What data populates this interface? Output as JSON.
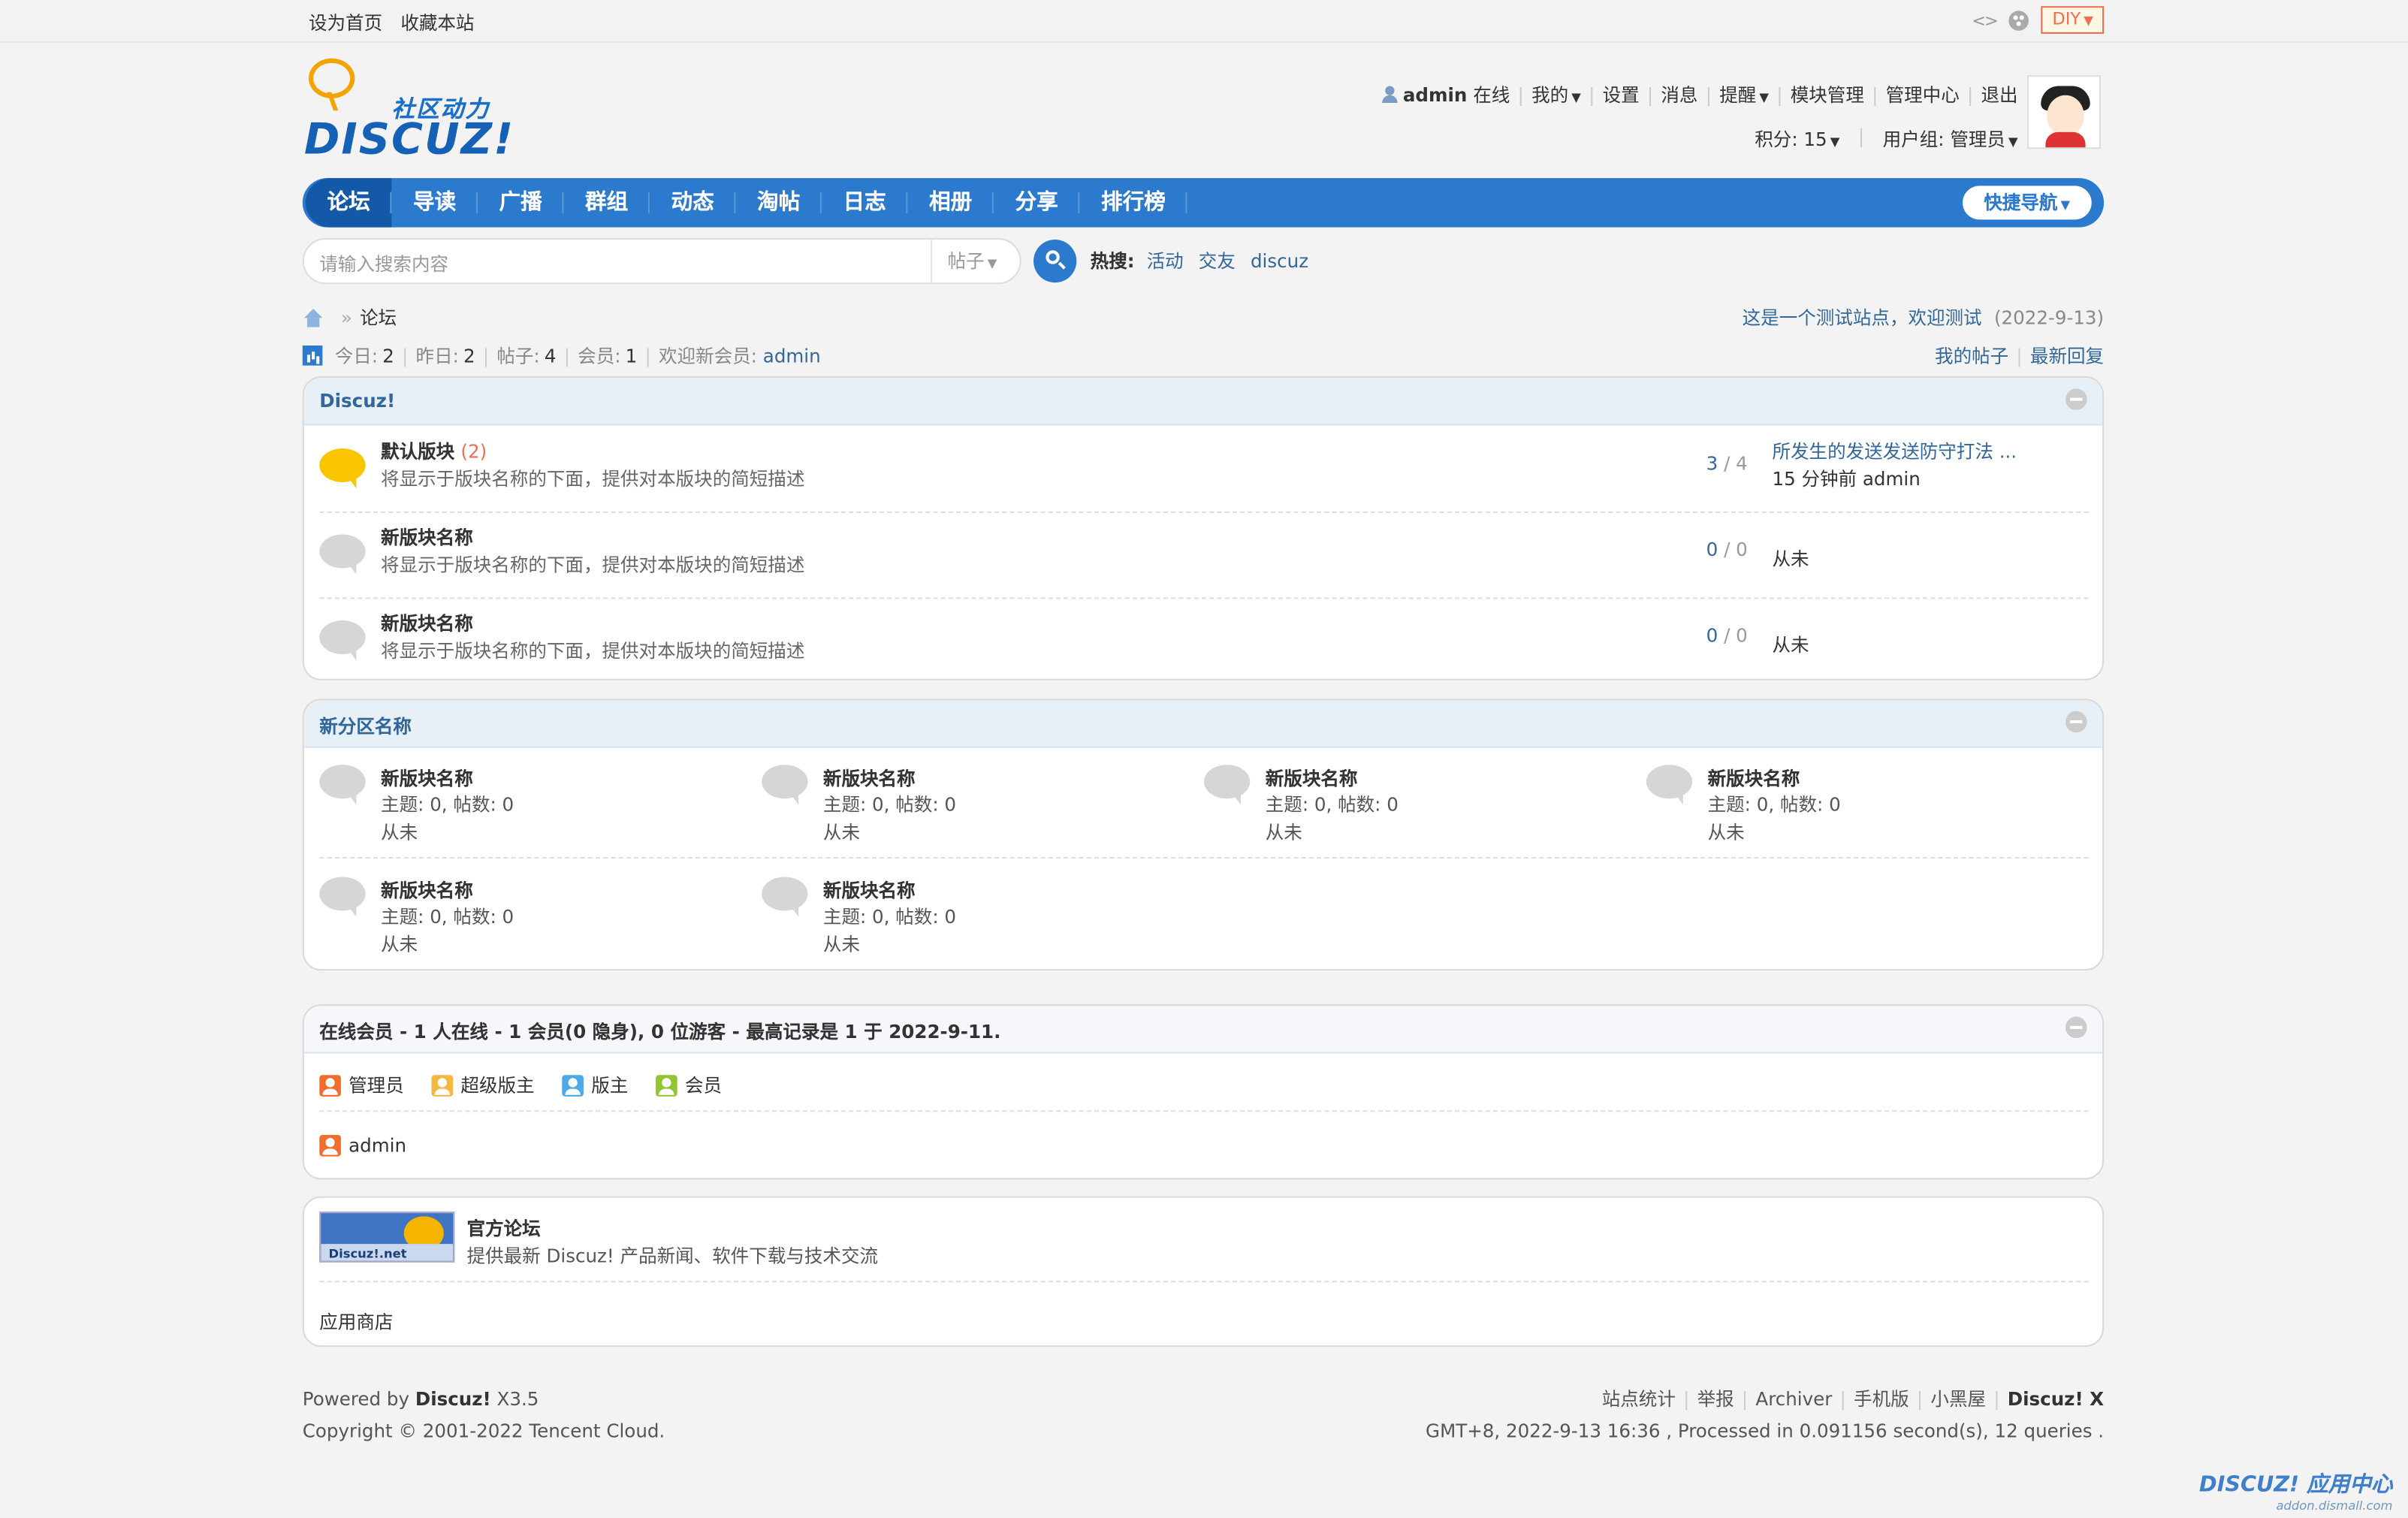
{
  "topbar": {
    "set_home": "设为首页",
    "bookmark": "收藏本站",
    "code_icon": "<>",
    "diy": "DIY"
  },
  "logo": {
    "cn": "社区动力",
    "en": "DISCUZ!"
  },
  "user": {
    "name": "admin",
    "status": "在线",
    "menu": [
      "我的",
      "设置",
      "消息",
      "提醒",
      "模块管理",
      "管理中心",
      "退出"
    ],
    "points_label": "积分: 15",
    "group_label": "用户组: 管理员"
  },
  "nav": {
    "items": [
      "论坛",
      "导读",
      "广播",
      "群组",
      "动态",
      "淘帖",
      "日志",
      "相册",
      "分享",
      "排行榜"
    ],
    "quick": "快捷导航"
  },
  "search": {
    "placeholder": "请输入搜索内容",
    "type": "帖子",
    "hot_label": "热搜:",
    "hot": [
      "活动",
      "交友",
      "discuz"
    ]
  },
  "breadcrumb": {
    "current": "论坛"
  },
  "notice": {
    "text": "这是一个测试站点，欢迎测试",
    "date": "(2022-9-13)"
  },
  "stats": {
    "today_label": "今日:",
    "today": "2",
    "yesterday_label": "昨日:",
    "yesterday": "2",
    "posts_label": "帖子:",
    "posts": "4",
    "members_label": "会员:",
    "members": "1",
    "newest_label": "欢迎新会员:",
    "newest": "admin"
  },
  "mylinks": {
    "my_posts": "我的帖子",
    "latest_reply": "最新回复"
  },
  "category1": {
    "title": "Discuz!",
    "forums": [
      {
        "name": "默认版块",
        "count": "(2)",
        "desc": "将显示于版块名称的下面，提供对本版块的简短描述",
        "threads": "3",
        "posts": "4",
        "last_title": "所发生的发送发送防守打法 ...",
        "last_meta": "15 分钟前 admin"
      },
      {
        "name": "新版块名称",
        "count": "",
        "desc": "将显示于版块名称的下面，提供对本版块的简短描述",
        "threads": "0",
        "posts": "0",
        "last_title": "从未",
        "last_meta": ""
      },
      {
        "name": "新版块名称",
        "count": "",
        "desc": "将显示于版块名称的下面，提供对本版块的简短描述",
        "threads": "0",
        "posts": "0",
        "last_title": "从未",
        "last_meta": ""
      }
    ]
  },
  "category2": {
    "title": "新分区名称",
    "forums": [
      {
        "name": "新版块名称",
        "stats": "主题: 0, 帖数: 0",
        "last": "从未"
      },
      {
        "name": "新版块名称",
        "stats": "主题: 0, 帖数: 0",
        "last": "从未"
      },
      {
        "name": "新版块名称",
        "stats": "主题: 0, 帖数: 0",
        "last": "从未"
      },
      {
        "name": "新版块名称",
        "stats": "主题: 0, 帖数: 0",
        "last": "从未"
      },
      {
        "name": "新版块名称",
        "stats": "主题: 0, 帖数: 0",
        "last": "从未"
      },
      {
        "name": "新版块名称",
        "stats": "主题: 0, 帖数: 0",
        "last": "从未"
      }
    ]
  },
  "online": {
    "title": "在线会员 - 1 人在线 - 1 会员(0 隐身), 0 位游客 - 最高记录是 1 于 2022-9-11.",
    "legend": [
      "管理员",
      "超级版主",
      "版主",
      "会员"
    ],
    "users": [
      "admin"
    ]
  },
  "links": {
    "banner_text": "Discuz!.net",
    "name": "官方论坛",
    "desc": "提供最新 Discuz! 产品新闻、软件下载与技术交流",
    "app_store": "应用商店"
  },
  "footer": {
    "powered_prefix": "Powered by",
    "powered_brand": "Discuz!",
    "powered_version": "X3.5",
    "copyright": "Copyright © 2001-2022 Tencent Cloud.",
    "links": [
      "站点统计",
      "举报",
      "Archiver",
      "手机版",
      "小黑屋"
    ],
    "brand": "Discuz! X",
    "processed": "GMT+8, 2022-9-13 16:36 , Processed in 0.091156 second(s), 12 queries ."
  },
  "watermark": {
    "title": "DISCUZ! 应用中心",
    "sub": "addon.dismall.com"
  }
}
